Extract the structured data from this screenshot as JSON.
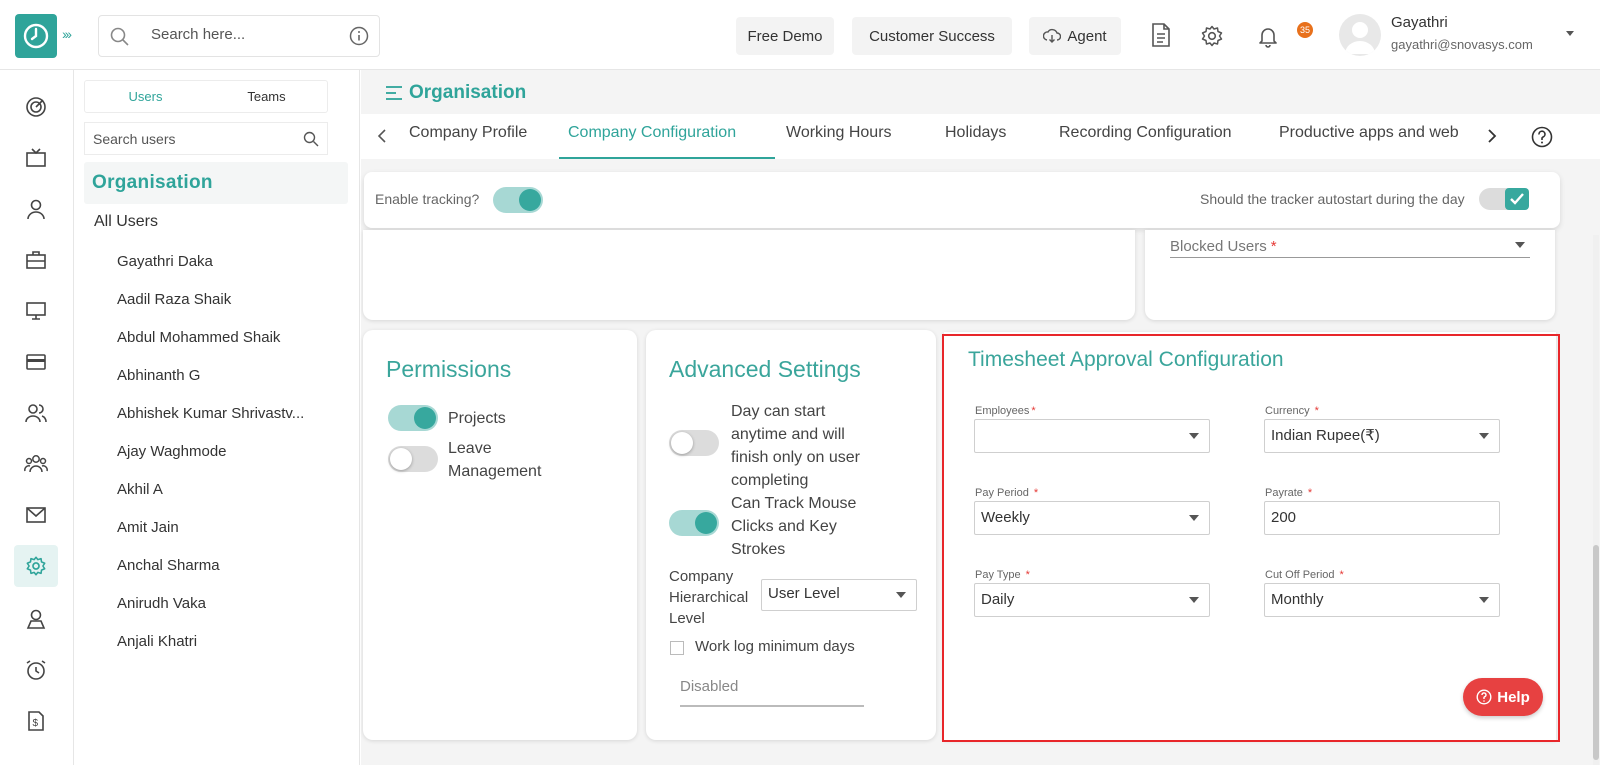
{
  "header": {
    "search_placeholder": "Search here...",
    "free_demo": "Free Demo",
    "customer_success": "Customer Success",
    "agent": "Agent",
    "notification_count": "35",
    "user_name": "Gayathri",
    "user_email": "gayathri@snovasys.com"
  },
  "user_panel": {
    "tab_users": "Users",
    "tab_teams": "Teams",
    "search_placeholder": "Search users",
    "org_title": "Organisation",
    "all_users": "All Users",
    "users": [
      "Gayathri Daka",
      "Aadil Raza Shaik",
      "Abdul Mohammed Shaik",
      "Abhinanth G",
      "Abhishek Kumar Shrivastv...",
      "Ajay Waghmode",
      "Akhil A",
      "Amit Jain",
      "Anchal Sharma",
      "Anirudh Vaka",
      "Anjali Khatri"
    ]
  },
  "main": {
    "title": "Organisation",
    "tabs": [
      "Company Profile",
      "Company Configuration",
      "Working Hours",
      "Holidays",
      "Recording Configuration",
      "Productive apps and web"
    ],
    "enable_tracking": "Enable tracking?",
    "autostart": "Should the tracker autostart during the day",
    "blocked_users": "Blocked Users",
    "req_mark": "*"
  },
  "permissions": {
    "title": "Permissions",
    "projects": "Projects",
    "leave_line1": "Leave",
    "leave_line2": "Management"
  },
  "advanced": {
    "title": "Advanced Settings",
    "day_start": [
      "Day can start",
      "anytime and will",
      "finish only on user",
      "completing"
    ],
    "track_mouse": [
      "Can Track Mouse",
      "Clicks and Key",
      "Strokes"
    ],
    "hierarchy": [
      "Company",
      "Hierarchical",
      "Level"
    ],
    "hierarchy_value": "User Level",
    "worklog": "Work log minimum days",
    "disabled": "Disabled"
  },
  "timesheet": {
    "title": "Timesheet Approval Configuration",
    "employees_label": "Employees",
    "employees_value": "",
    "currency_label": "Currency",
    "currency_value": "Indian Rupee(₹)",
    "pay_period_label": "Pay Period",
    "pay_period_value": "Weekly",
    "payrate_label": "Payrate",
    "payrate_value": "200",
    "pay_type_label": "Pay Type",
    "pay_type_value": "Daily",
    "cutoff_label": "Cut Off Period",
    "cutoff_value": "Monthly"
  },
  "help": "Help"
}
